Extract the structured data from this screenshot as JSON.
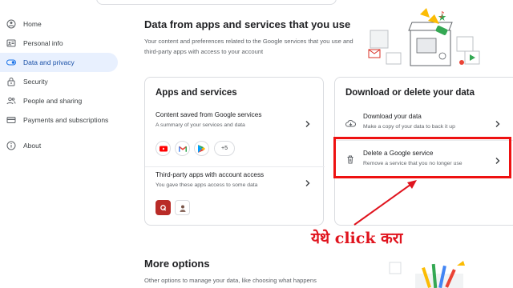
{
  "sidebar": {
    "items": [
      {
        "label": "Home",
        "icon": "home-icon"
      },
      {
        "label": "Personal info",
        "icon": "id-card-icon"
      },
      {
        "label": "Data and privacy",
        "icon": "toggle-icon",
        "active": true
      },
      {
        "label": "Security",
        "icon": "lock-icon"
      },
      {
        "label": "People and sharing",
        "icon": "people-icon"
      },
      {
        "label": "Payments and subscriptions",
        "icon": "credit-card-icon"
      },
      {
        "label": "About",
        "icon": "info-icon"
      }
    ]
  },
  "main": {
    "title": "Data from apps and services that you use",
    "subtitle": "Your content and preferences related to the Google services that you use and third-party apps with access to your account",
    "apps_card": {
      "title": "Apps and services",
      "content_saved": {
        "title": "Content saved from Google services",
        "desc": "A summary of your services and data",
        "apps": [
          "youtube-icon",
          "gmail-icon",
          "play-store-icon"
        ],
        "more": "+5"
      },
      "third_party": {
        "title": "Third-party apps with account access",
        "desc": "You gave these apps access to some data"
      }
    },
    "download_card": {
      "title": "Download or delete your data",
      "download": {
        "title": "Download your data",
        "desc": "Make a copy of your data to back it up"
      },
      "delete": {
        "title": "Delete a Google service",
        "desc": "Remove a service that you no longer use"
      }
    },
    "annotation": "येथे click करा",
    "more_options": {
      "title": "More options",
      "subtitle": "Other options to manage your data, like choosing what happens"
    }
  },
  "colors": {
    "accent": "#1a73e8",
    "active_bg": "#e8f0fe",
    "highlight": "#ee1111",
    "annotation": "#e0141e"
  }
}
